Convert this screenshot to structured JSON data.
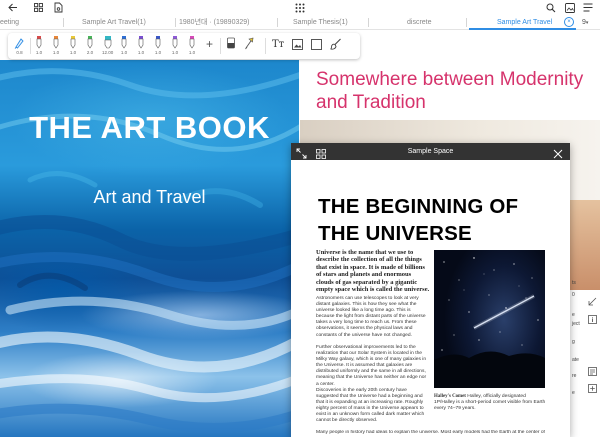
{
  "topbar": {
    "icons": [
      "back-arrow-icon",
      "grid-icon",
      "document-link-icon",
      "apps-grid-icon",
      "search-icon",
      "image-icon",
      "menu-icon"
    ]
  },
  "tabs": [
    {
      "label": "eeting",
      "active": false
    },
    {
      "label": "Sample Art Travel(1)",
      "active": false
    },
    {
      "label": "1980년대 ·  (19890329)",
      "active": false
    },
    {
      "label": "Sample Thesis(1)",
      "active": false
    },
    {
      "label": "discrete",
      "active": false
    },
    {
      "label": "Sample Art Travel",
      "active": true
    }
  ],
  "tab_overflow": "9",
  "tab_close_glyph": "×",
  "toolbar": {
    "pens": [
      {
        "size": "0.8",
        "color": "#2f8de4",
        "icon": "fountain-pen-icon"
      },
      {
        "size": "1.0",
        "color": "#d84a4a",
        "icon": "pen-icon"
      },
      {
        "size": "1.0",
        "color": "#e8873a",
        "icon": "pen-icon"
      },
      {
        "size": "1.0",
        "color": "#e8c83a",
        "icon": "pen-icon"
      },
      {
        "size": "2.0",
        "color": "#49b35a",
        "icon": "pen-icon"
      },
      {
        "size": "12.00",
        "color": "#34b7c4",
        "icon": "highlighter-icon"
      },
      {
        "size": "1.0",
        "color": "#2f6fd4",
        "icon": "pen-icon"
      },
      {
        "size": "1.0",
        "color": "#7a4fd1",
        "icon": "pen-icon"
      },
      {
        "size": "1.0",
        "color": "#3a56c7",
        "icon": "pen-icon"
      },
      {
        "size": "1.0",
        "color": "#8e5bd6",
        "icon": "pen-icon"
      },
      {
        "size": "1.0",
        "color": "#d64ab8",
        "icon": "pen-icon"
      }
    ],
    "tools": [
      "add-pen-icon",
      "eraser-icon",
      "lasso-icon",
      "text-tool-icon",
      "image-tool-icon",
      "shape-tool-icon",
      "paint-brush-icon"
    ],
    "add_glyph": "+",
    "text_glyph": "Tт"
  },
  "left_page": {
    "title": "THE ART BOOK",
    "subtitle": "Art and Travel"
  },
  "right_page": {
    "heading": "Somewhere between Modernity and Tradition",
    "side_text": [
      "ts",
      "0",
      "e",
      "ject",
      "g",
      "ate",
      "re",
      "e"
    ],
    "side_icons": [
      "resize-icon",
      "info-icon",
      "note-icon",
      "add-page-icon"
    ]
  },
  "panel": {
    "title": "Sample Space",
    "doc_title": "THE BEGINNING OF THE UNIVERSE",
    "lead": "Universe is the name that we use to describe the collection of all the things that exist in space. It is made of billions of stars and planets and enormous clouds of gas separated by a gigantic empty space which is called the universe.",
    "paragraphs": [
      "Astronomers can use telescopes to look at very distant galaxies. This is how they see what the universe looked like a long time ago. This is because the light from distant parts of the universe takes a very long time to reach us. From these observations, it seems the physical laws and constants of the universe have not changed.",
      "Further observational improvements led to the realization that our Solar System is located in the Milky Way galaxy, which is one of many galaxies in the Universe. It is assumed that galaxies are distributed uniformly and the same in all directions, meaning that the Universe has neither an edge nor a center.",
      "Discoveries in the early 20th century have suggested that the Universe had a beginning and that it is expanding at an increasing rate. Roughly eighty percent of mass in the Universe appears to exist in an unknown form called dark matter which cannot be directly observed."
    ],
    "caption_bold": "Halley's Comet",
    "caption": " Halley, officially designated 1P/Halley is a short-period comet visible from Earth every 74–79 years.",
    "bottom_text": "Many people in history had ideas to explain the universe. Most early models had the Earth at the center of"
  }
}
